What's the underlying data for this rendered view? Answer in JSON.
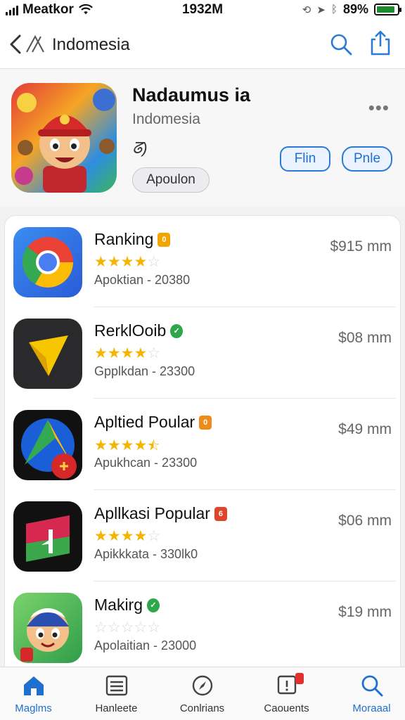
{
  "status_bar": {
    "carrier": "Meatkor",
    "time": "1932M",
    "battery_pct": "89%",
    "battery_level": 0.89
  },
  "nav": {
    "title": "Indomesia",
    "back_icon": "chevron-left-icon",
    "search_icon": "search-icon",
    "share_icon": "share-icon"
  },
  "app": {
    "title": "Nadaumus ia",
    "subtitle": "Indomesia",
    "glyph": "ᘔ)",
    "chip_label": "Apoulon",
    "more_label": "•••",
    "pill_1": "Flin",
    "pill_2": "Pnle"
  },
  "list": [
    {
      "name": "Ranking",
      "badge_color": "#f2a500",
      "stars": 4,
      "half": false,
      "meta": "Apoktian  -  20380",
      "price": "$915 mm"
    },
    {
      "name": "RerklOoib",
      "badge_color": "#2ca84a",
      "stars": 4,
      "half": false,
      "meta": "Gpplkdan  -  23300",
      "price": "$08 mm"
    },
    {
      "name": "Apltied Poular",
      "badge_color": "#f08a1a",
      "stars": 4,
      "half": true,
      "meta": "Apukhcan  -  23300",
      "price": "$49 mm"
    },
    {
      "name": "Apllkasi Popular",
      "badge_color": "#e0452a",
      "stars": 4,
      "half": false,
      "meta": "Apikkkata  -  330lk0",
      "price": "$06 mm"
    },
    {
      "name": "Makirg",
      "badge_color": "#2ca84a",
      "stars": 0,
      "half": false,
      "meta": "Apolaitian  -  23000",
      "price": "$19 mm"
    }
  ],
  "tabs": [
    {
      "label": "Maglms",
      "icon": "home-icon",
      "active": true
    },
    {
      "label": "Hanleete",
      "icon": "newspaper-icon",
      "active": false
    },
    {
      "label": "Conlrians",
      "icon": "compass-icon",
      "active": false
    },
    {
      "label": "Caouents",
      "icon": "updates-icon",
      "active": false
    },
    {
      "label": "Moraaal",
      "icon": "search-icon",
      "active": false
    }
  ],
  "colors": {
    "accent": "#1f6fcf",
    "star": "#f5b400"
  }
}
